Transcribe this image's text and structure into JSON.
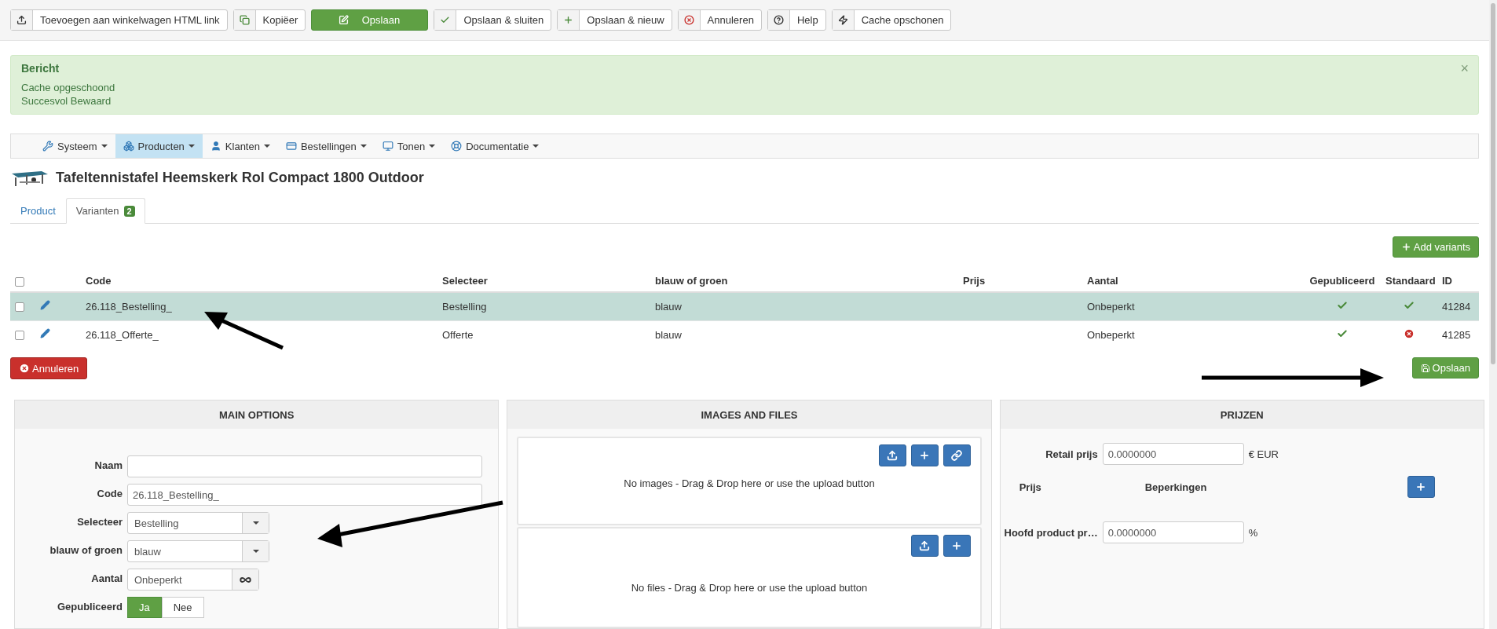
{
  "toolbar": [
    {
      "label": "Toevoegen aan winkelwagen HTML link",
      "kind": "upload"
    },
    {
      "label": "Kopiëer",
      "kind": "copy"
    },
    {
      "label": "Opslaan",
      "kind": "save"
    },
    {
      "label": "Opslaan & sluiten",
      "kind": "check"
    },
    {
      "label": "Opslaan & nieuw",
      "kind": "plus"
    },
    {
      "label": "Annuleren",
      "kind": "cancel"
    },
    {
      "label": "Help",
      "kind": "help"
    },
    {
      "label": "Cache opschonen",
      "kind": "cache"
    }
  ],
  "message": {
    "title": "Bericht",
    "close": "×",
    "lines": [
      "Cache opgeschoond",
      "Succesvol Bewaard"
    ]
  },
  "menu": [
    {
      "label": "Systeem",
      "kind": "wrench",
      "selected": false
    },
    {
      "label": "Producten",
      "kind": "products",
      "selected": true
    },
    {
      "label": "Klanten",
      "kind": "user",
      "selected": false
    },
    {
      "label": "Bestellingen",
      "kind": "card",
      "selected": false
    },
    {
      "label": "Tonen",
      "kind": "monitor",
      "selected": false
    },
    {
      "label": "Documentatie",
      "kind": "lifebuoy",
      "selected": false
    }
  ],
  "product_title": "Tafeltennistafel Heemskerk Rol Compact 1800 Outdoor",
  "tabs": [
    {
      "label": "Product",
      "selected": false
    },
    {
      "label": "Varianten",
      "badge": "2",
      "selected": true
    }
  ],
  "add_variants": "Add variants",
  "table": {
    "all_checked": false,
    "columns": [
      "Code",
      "Selecteer",
      "blauw of groen",
      "Prijs",
      "Aantal",
      "Gepubliceerd",
      "Standaard",
      "ID"
    ],
    "rows": [
      {
        "checked": false,
        "selected": true,
        "code": "26.118_Bestelling_",
        "selecteer": "Bestelling",
        "kleur": "blauw",
        "aantal": "Onbeperkt",
        "published": true,
        "standard": true,
        "id": "41284"
      },
      {
        "checked": false,
        "selected": false,
        "code": "26.118_Offerte_",
        "selecteer": "Offerte",
        "kleur": "blauw",
        "aantal": "Onbeperkt",
        "published": true,
        "standard": false,
        "id": "41285"
      }
    ]
  },
  "cancel_button": "Annuleren",
  "save_button": "Opslaan",
  "main_options": {
    "title": "MAIN OPTIONS",
    "fields": [
      {
        "kind": "text",
        "label": "Naam"
      },
      {
        "kind": "text",
        "label": "Code",
        "value": "26.118_Bestelling_"
      },
      {
        "kind": "select",
        "label": "Selecteer",
        "value": "Bestelling"
      },
      {
        "kind": "select",
        "label": "blauw of groen",
        "value": "blauw"
      },
      {
        "kind": "unlimited",
        "label": "Aantal",
        "value": "Onbeperkt"
      },
      {
        "kind": "toggle",
        "label": "Gepubliceerd",
        "options": [
          {
            "label": "Ja",
            "selected": true
          },
          {
            "label": "Nee",
            "selected": false
          }
        ]
      }
    ]
  },
  "images_files": {
    "title": "IMAGES AND FILES",
    "images": {
      "text": "No images - Drag & Drop here or use the upload button",
      "buttons": [
        {
          "kind": "upload"
        },
        {
          "kind": "plus"
        },
        {
          "kind": "link"
        }
      ]
    },
    "files": {
      "text": "No files - Drag & Drop here or use the upload button",
      "buttons": [
        {
          "kind": "upload"
        },
        {
          "kind": "plus"
        }
      ]
    }
  },
  "prijzen": {
    "title": "PRIJZEN",
    "retail_label": "Retail prijs",
    "retail_value": "0.0000000",
    "retail_unit": "€ EUR",
    "columns": [
      "Prijs",
      "Beperkingen"
    ],
    "main_label": "Hoofd product pr…",
    "main_value": "0.0000000",
    "main_unit": "%"
  }
}
